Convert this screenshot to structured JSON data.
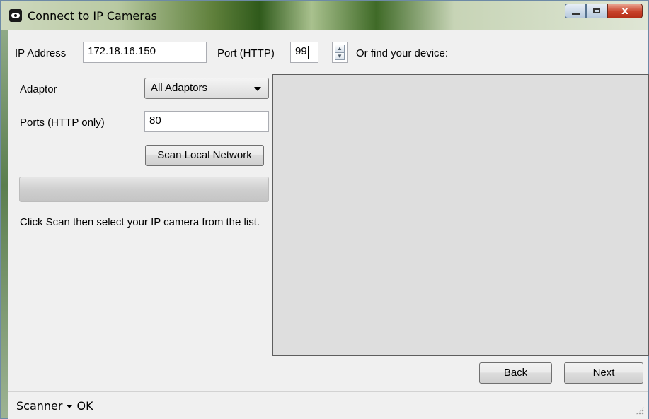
{
  "window": {
    "title": "Connect to IP Cameras",
    "icon": "eye-camera-icon",
    "controls": {
      "minimize": "minimize-icon",
      "maximize": "maximize-icon",
      "close_glyph": "x"
    }
  },
  "form": {
    "ip_label": "IP Address",
    "ip_value": "172.18.16.150",
    "port_label": "Port (HTTP)",
    "port_value": "99",
    "find_label": "Or find your device:",
    "adaptor_label": "Adaptor",
    "adaptor_value": "All Adaptors",
    "ports_label": "Ports (HTTP only)",
    "ports_value": "80",
    "scan_button": "Scan Local Network",
    "progress": 0,
    "hint": "Click Scan then select your IP camera from the list."
  },
  "buttons": {
    "back": "Back",
    "next": "Next"
  },
  "status": {
    "dropdown": "Scanner",
    "text": "OK"
  },
  "colors": {
    "titlebar_green": "#2f5a1b",
    "close_red": "#c8422a",
    "list_bg": "#dedede"
  }
}
